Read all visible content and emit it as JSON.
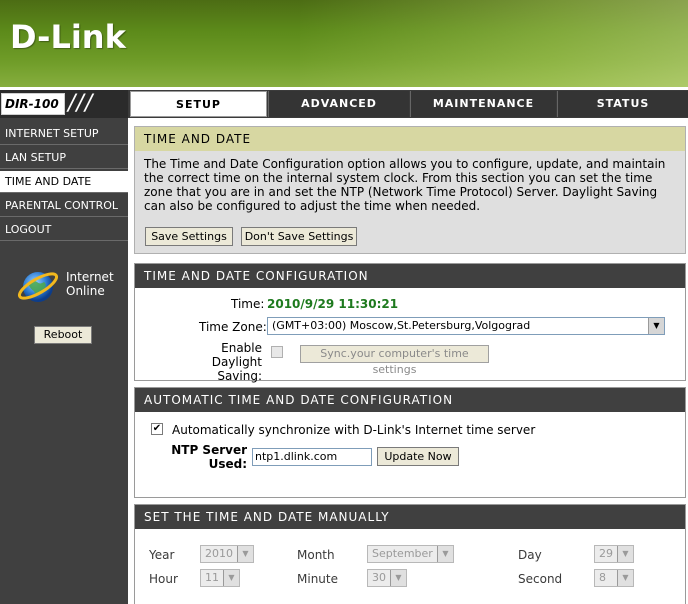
{
  "brand": {
    "logo": "D-Link",
    "model": "DIR-100",
    "slashes": "///"
  },
  "tabs": [
    {
      "label": "SETUP"
    },
    {
      "label": "ADVANCED"
    },
    {
      "label": "MAINTENANCE"
    },
    {
      "label": "STATUS"
    }
  ],
  "sidebar": {
    "items": [
      {
        "label": "INTERNET SETUP"
      },
      {
        "label": "LAN SETUP"
      },
      {
        "label": "TIME AND DATE"
      },
      {
        "label": "PARENTAL CONTROL"
      },
      {
        "label": "LOGOUT"
      }
    ],
    "status_line1": "Internet",
    "status_line2": "Online",
    "reboot_label": "Reboot"
  },
  "intro": {
    "title": "TIME AND DATE",
    "text": "The Time and Date Configuration option allows you to configure, update, and maintain the correct time on the internal system clock. From this section you can set the time zone that you are in and set the NTP (Network Time Protocol) Server. Daylight Saving can also be configured to adjust the time when needed.",
    "save_label": "Save Settings",
    "dont_save_label": "Don't Save Settings"
  },
  "config": {
    "title": "TIME AND DATE CONFIGURATION",
    "time_label": "Time:",
    "time_value": "2010/9/29 11:30:21",
    "timezone_label": "Time Zone:",
    "timezone_value": "(GMT+03:00) Moscow,St.Petersburg,Volgograd",
    "daylight_label_1": "Enable Daylight",
    "daylight_label_2": "Saving:",
    "daylight_checked": false,
    "sync_label": "Sync.your computer's time settings"
  },
  "auto": {
    "title": "AUTOMATIC TIME AND DATE CONFIGURATION",
    "checkbox_label": "Automatically synchronize with D-Link's Internet time server",
    "checkbox_checked": true,
    "check_mark": "✔",
    "ntp_label_1": "NTP Server",
    "ntp_label_2": "Used:",
    "ntp_value": "ntp1.dlink.com",
    "update_label": "Update Now"
  },
  "manual": {
    "title": "SET THE TIME AND DATE MANUALLY",
    "year_label": "Year",
    "year_value": "2010",
    "month_label": "Month",
    "month_value": "September",
    "day_label": "Day",
    "day_value": "29",
    "hour_label": "Hour",
    "hour_value": "11",
    "minute_label": "Minute",
    "minute_value": "30",
    "second_label": "Second",
    "second_value": "8"
  },
  "icons": {
    "dropdown": "chevron-down-icon",
    "globe": "globe-icon"
  },
  "colors": {
    "header_green": "#5c8a1a",
    "dark_bar": "#404040",
    "time_green": "#1e7a1e",
    "intro_title_bg": "#d7d7a2"
  }
}
